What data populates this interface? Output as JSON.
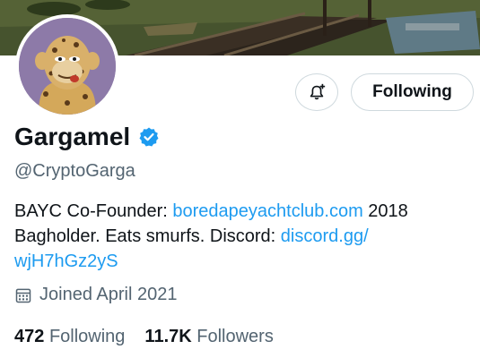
{
  "profile": {
    "display_name": "Gargamel",
    "handle": "@CryptoGarga",
    "follow_button_label": "Following",
    "bio": {
      "part1": "BAYC Co-Founder: ",
      "link1": "boredapeyachtclub.com",
      "part2": "  2018",
      "part3": "Bagholder. Eats smurfs.   Discord: ",
      "link2a": "discord.gg/",
      "link2b": "wjH7hGz2yS"
    },
    "joined": "Joined April 2021",
    "stats": {
      "following_count": "472",
      "following_label": "Following",
      "followers_count": "11.7K",
      "followers_label": "Followers"
    }
  },
  "icons": {
    "notification": "bell-plus-icon",
    "verified": "verified-badge-icon",
    "calendar": "calendar-icon"
  },
  "colors": {
    "link": "#1d9bf0",
    "secondary_text": "#536471",
    "primary_text": "#0f1419",
    "border": "#cfd9de"
  }
}
